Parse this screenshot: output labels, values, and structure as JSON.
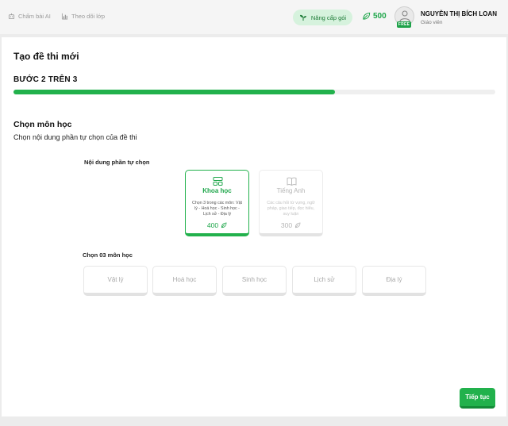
{
  "nav": {
    "items": [
      {
        "label": "Chấm bài AI",
        "icon": "robot-icon"
      },
      {
        "label": "Theo dõi lớp",
        "icon": "chart-icon"
      }
    ]
  },
  "header": {
    "upgrade_label": "Nâng cấp gói",
    "credits": "500",
    "plan_badge": "FREE",
    "user_name": "NGUYỄN THỊ BÍCH LOAN",
    "user_role": "Giáo viên"
  },
  "main": {
    "title": "Tạo đề thi mới",
    "step_label": "BƯỚC 2 TRÊN 3",
    "progress_fraction": 0.667,
    "section_title": "Chọn môn học",
    "section_subtitle": "Chọn nội dung phần tự chọn của đề thi",
    "optional_label": "Nội dung phần tự chọn",
    "options": [
      {
        "title": "Khoa học",
        "desc": "Chọn 3 trong các môn: Vật lý - Hoá học - Sinh học - Lịch sử - Địa lý",
        "price": "400",
        "selected": true,
        "icon": "layout-icon"
      },
      {
        "title": "Tiếng Anh",
        "desc": "Các câu hỏi từ vựng, ngữ pháp, giao tiếp, đọc hiểu, suy luận",
        "price": "300",
        "selected": false,
        "icon": "book-icon"
      }
    ],
    "subjects_label": "Chọn 03 môn học",
    "subjects": [
      "Vật lý",
      "Hoá học",
      "Sinh học",
      "Lịch sử",
      "Địa lý"
    ],
    "continue_label": "Tiếp tục"
  },
  "colors": {
    "accent": "#22b14c",
    "accent_light": "#d6f2dd"
  }
}
